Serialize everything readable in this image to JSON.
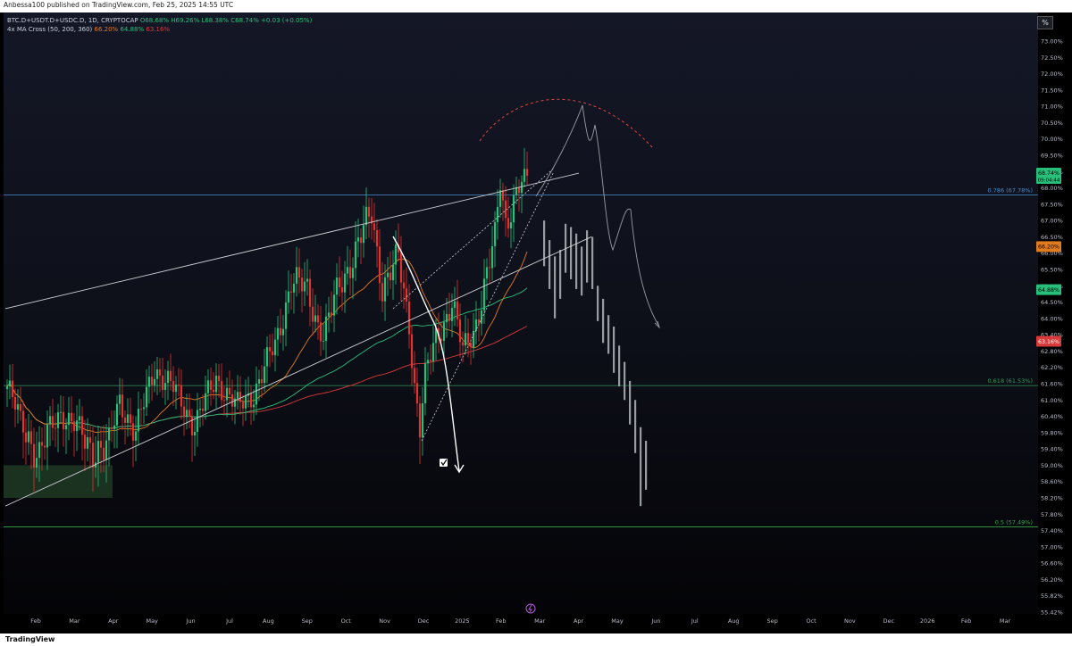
{
  "header": {
    "publisher": "Anbessa100 published on TradingView.com, Feb 25, 2025 14:55 UTC"
  },
  "legend": {
    "symbol": "BTC.D+USDT.D+USDC.D, 1D, CRYPTOCAP",
    "ohlc": "O68.68% H69.26% L68.38% C68.74% +0.03 (+0.05%)",
    "indicator": "4x MA Cross (50, 200, 360)",
    "ma50": "66.20%",
    "ma200": "64.88%",
    "ma360": "63.16%"
  },
  "toolbar": {
    "percent_button": "%"
  },
  "footer": {
    "brand": "TradingView"
  },
  "colors": {
    "up": "#26c07a",
    "down": "#e3332f",
    "ma50": "#e07b1e",
    "ma200": "#26c07a",
    "ma360": "#d83a3a",
    "fib_786": "#4a8fd0",
    "fib_618": "#2f9c5a",
    "fib_05": "#2fa84a"
  },
  "chart_data": {
    "type": "candlestick",
    "x_ticks": [
      "Feb",
      "Mar",
      "Apr",
      "May",
      "Jun",
      "Jul",
      "Aug",
      "Sep",
      "Oct",
      "Nov",
      "Dec",
      "2025",
      "Feb",
      "Mar",
      "Apr",
      "May",
      "Jun",
      "Jul",
      "Aug",
      "Sep",
      "Oct",
      "Nov",
      "Dec",
      "2026",
      "Feb",
      "Mar"
    ],
    "y_ticks": [
      "73.00%",
      "72.50%",
      "72.00%",
      "71.50%",
      "71.00%",
      "70.50%",
      "70.00%",
      "69.50%",
      "69.00%",
      "68.00%",
      "67.50%",
      "67.00%",
      "66.50%",
      "66.00%",
      "65.50%",
      "65.00%",
      "64.50%",
      "64.00%",
      "63.40%",
      "62.80%",
      "62.20%",
      "61.60%",
      "61.00%",
      "60.40%",
      "59.80%",
      "59.40%",
      "59.00%",
      "58.60%",
      "58.20%",
      "57.80%",
      "57.40%",
      "57.00%",
      "56.60%",
      "56.20%",
      "55.82%",
      "55.42%"
    ],
    "last_price": {
      "value": "68.74%",
      "countdown": "09:04:44"
    },
    "ma_labels": [
      {
        "key": "ma50",
        "value": "66.20%"
      },
      {
        "key": "ma200",
        "value": "64.88%"
      },
      {
        "key": "ma360",
        "value": "63.16%"
      }
    ],
    "fib_levels": [
      {
        "label": "0.786 (67.78%)",
        "value": 67.78
      },
      {
        "label": "0.618 (61.53%)",
        "value": 61.53
      },
      {
        "label": "0.5 (57.49%)",
        "value": 57.49
      }
    ],
    "price_anchors": [
      [
        0,
        61.5
      ],
      [
        5,
        60.2
      ],
      [
        12,
        59.2
      ],
      [
        20,
        60.6
      ],
      [
        30,
        59.5
      ],
      [
        38,
        59.4
      ],
      [
        42,
        61.0
      ],
      [
        48,
        59.8
      ],
      [
        55,
        62.2
      ],
      [
        62,
        61.4
      ],
      [
        70,
        60.1
      ],
      [
        78,
        61.8
      ],
      [
        86,
        60.7
      ],
      [
        92,
        61.3
      ],
      [
        100,
        63.0
      ],
      [
        106,
        65.2
      ],
      [
        112,
        64.8
      ],
      [
        118,
        63.4
      ],
      [
        124,
        65.0
      ],
      [
        130,
        66.1
      ],
      [
        136,
        67.2
      ],
      [
        140,
        65.0
      ],
      [
        146,
        65.8
      ],
      [
        150,
        63.8
      ],
      [
        152,
        61.6
      ],
      [
        154,
        60.0
      ],
      [
        156,
        61.8
      ],
      [
        160,
        63.3
      ],
      [
        166,
        64.5
      ],
      [
        170,
        62.8
      ],
      [
        174,
        63.6
      ],
      [
        178,
        64.9
      ],
      [
        182,
        66.4
      ],
      [
        184,
        68.3
      ],
      [
        186,
        67.0
      ],
      [
        188,
        67.4
      ],
      [
        191,
        68.0
      ],
      [
        194,
        68.74
      ]
    ],
    "grid": false
  }
}
